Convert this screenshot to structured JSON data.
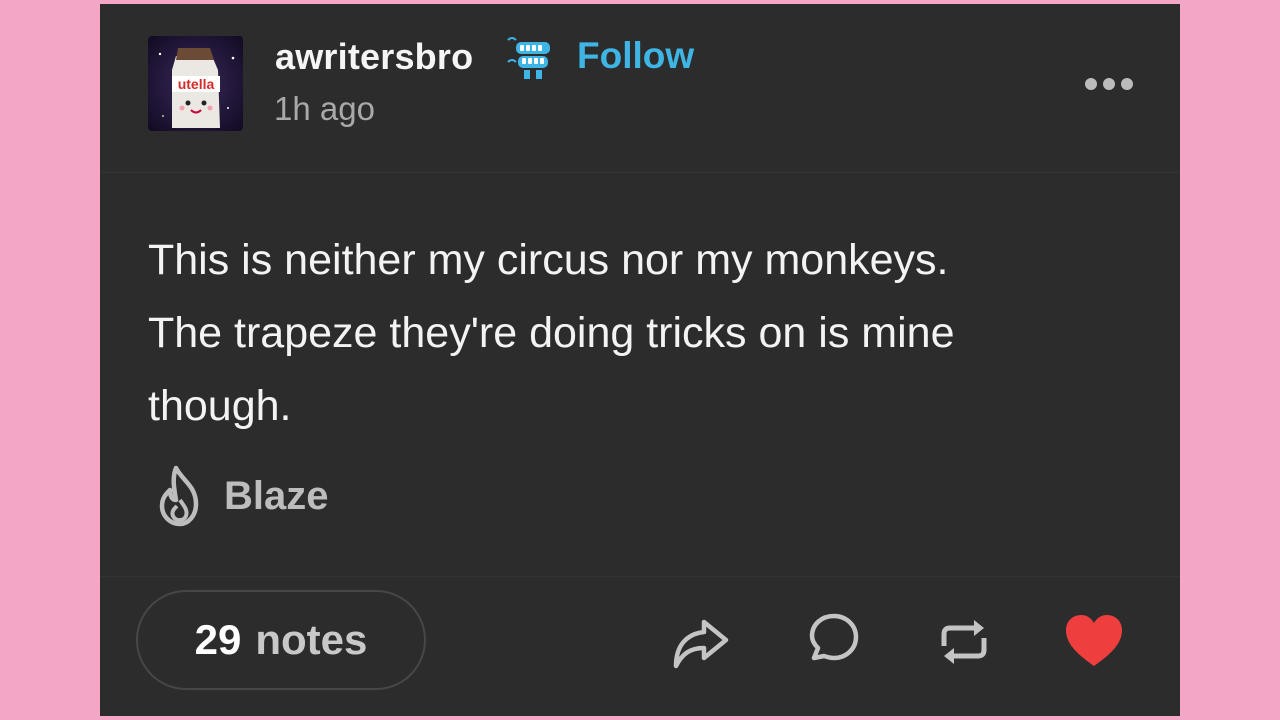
{
  "post": {
    "username": "awritersbro",
    "follow_label": "Follow",
    "time_ago": "1h ago",
    "text_lines": [
      "This is neither my circus nor my monkeys.",
      "The trapeze they're doing tricks on is mine",
      "though."
    ],
    "avatar_label": "utella"
  },
  "blaze": {
    "label": "Blaze",
    "icon": "flame-icon"
  },
  "footer": {
    "notes_count": "29",
    "notes_label": "notes",
    "actions": [
      "share-icon",
      "reply-icon",
      "reblog-icon",
      "like-icon"
    ]
  },
  "colors": {
    "background": "#f4a6c6",
    "card": "#2c2c2c",
    "follow": "#3fb5e6",
    "like": "#ef3e3e"
  }
}
